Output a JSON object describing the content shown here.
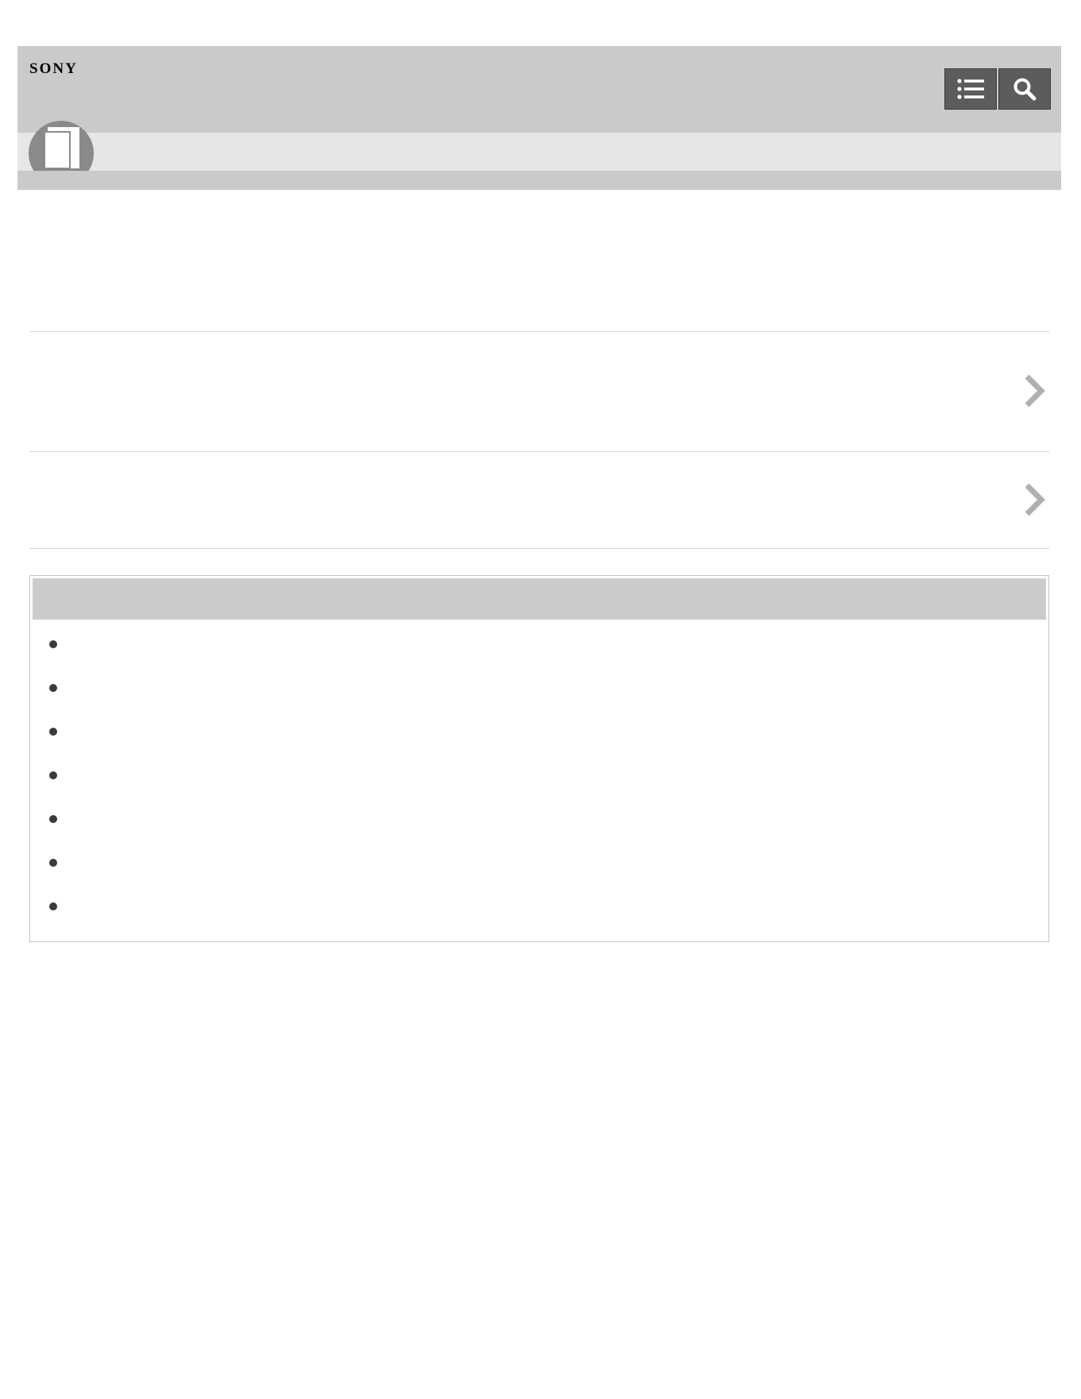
{
  "header": {
    "brand": "SONY",
    "toc_icon": "list-icon",
    "search_icon": "search-icon"
  },
  "subheader": {
    "icon": "book-icon"
  },
  "nav_rows": [
    {
      "icon": "chevron-right-icon"
    },
    {
      "icon": "chevron-right-icon"
    }
  ],
  "related_box": {
    "items": [
      {},
      {},
      {},
      {},
      {},
      {},
      {}
    ]
  },
  "colors": {
    "header_bg": "#cacaca",
    "subbar_bg": "#e6e6e6",
    "button_bg": "#5c5c5c",
    "chevron": "#b0b0b0"
  }
}
